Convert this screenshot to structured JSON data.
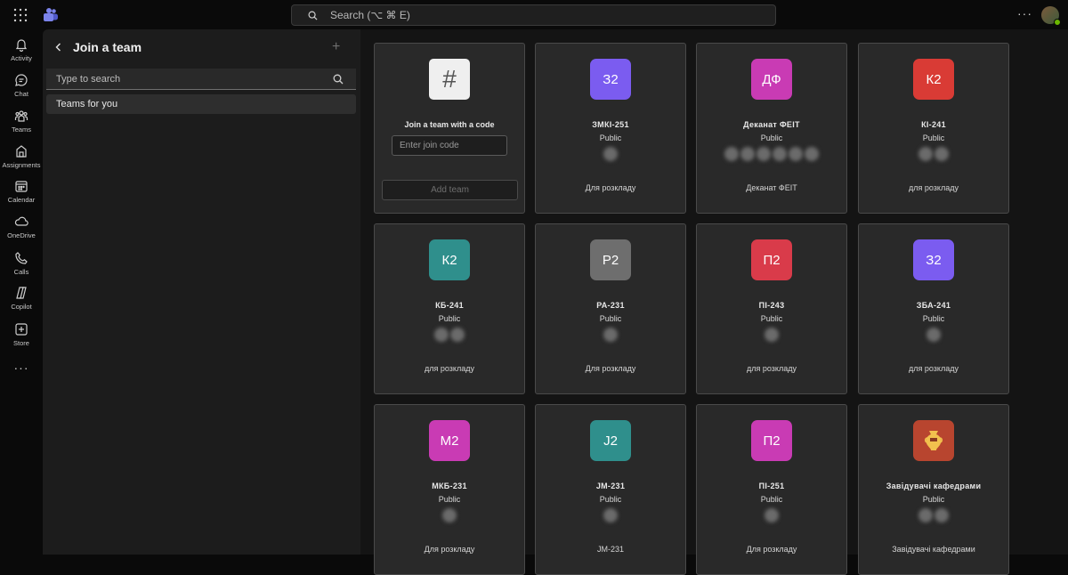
{
  "topbar": {
    "search_placeholder": "Search (⌥ ⌘ E)"
  },
  "rail": [
    {
      "label": "Activity",
      "icon": "bell-icon"
    },
    {
      "label": "Chat",
      "icon": "chat-icon"
    },
    {
      "label": "Teams",
      "icon": "teams-icon"
    },
    {
      "label": "Assignments",
      "icon": "assignments-icon"
    },
    {
      "label": "Calendar",
      "icon": "calendar-icon"
    },
    {
      "label": "OneDrive",
      "icon": "cloud-icon"
    },
    {
      "label": "Calls",
      "icon": "phone-icon"
    },
    {
      "label": "Copilot",
      "icon": "copilot-icon"
    },
    {
      "label": "Store",
      "icon": "store-icon"
    }
  ],
  "left_panel": {
    "title": "Join a team",
    "search_placeholder": "Type to search",
    "items": [
      {
        "label": "Teams for you"
      }
    ]
  },
  "join_code_card": {
    "title": "Join a team with a code",
    "input_placeholder": "Enter join code",
    "button_label": "Add team"
  },
  "teams": [
    {
      "initials": "З2",
      "color": "#7b5cf0",
      "name": "ЗМКІ-251",
      "visibility": "Public",
      "desc": "Для розкладу",
      "members": 1
    },
    {
      "initials": "ДФ",
      "color": "#c93bb4",
      "name": "Деканат ФЕІТ",
      "visibility": "Public",
      "desc": "Деканат ФЕІТ",
      "members": 6
    },
    {
      "initials": "К2",
      "color": "#d93b35",
      "name": "КІ-241",
      "visibility": "Public",
      "desc": "для розкладу",
      "members": 2
    },
    {
      "initials": "К2",
      "color": "#2f8f8c",
      "name": "КБ-241",
      "visibility": "Public",
      "desc": "для розкладу",
      "members": 2
    },
    {
      "initials": "Р2",
      "color": "#6e6e6e",
      "name": "РА-231",
      "visibility": "Public",
      "desc": "Для розкладу",
      "members": 1
    },
    {
      "initials": "П2",
      "color": "#d93b4a",
      "name": "ПІ-243",
      "visibility": "Public",
      "desc": "для розкладу",
      "members": 1
    },
    {
      "initials": "З2",
      "color": "#7b5cf0",
      "name": "ЗБА-241",
      "visibility": "Public",
      "desc": "для розкладу",
      "members": 1
    },
    {
      "initials": "М2",
      "color": "#c93bb4",
      "name": "МКБ-231",
      "visibility": "Public",
      "desc": "Для розкладу",
      "members": 1
    },
    {
      "initials": "J2",
      "color": "#2f8f8c",
      "name": "JM-231",
      "visibility": "Public",
      "desc": "JM-231",
      "members": 1
    },
    {
      "initials": "П2",
      "color": "#c93bb4",
      "name": "ПІ-251",
      "visibility": "Public",
      "desc": "Для розкладу",
      "members": 1
    },
    {
      "initials": "",
      "color": "#b8452f",
      "name": "Завідувачі кафедрами",
      "visibility": "Public",
      "desc": "Завідувачі кафедрами",
      "members": 2,
      "image": "amphora-icon"
    }
  ]
}
